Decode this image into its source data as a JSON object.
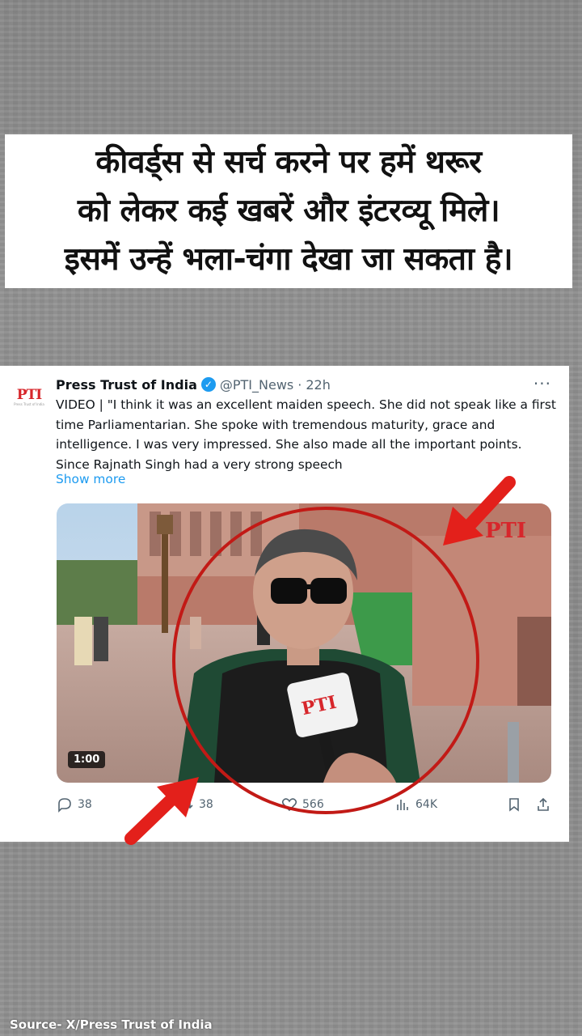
{
  "headline": {
    "lines": [
      "कीवर्ड्स से सर्च करने पर हमें थरूर",
      "को लेकर कई खबरें और इंटरव्यू मिले।",
      "इसमें उन्हें भला-चंगा देखा जा सकता है।"
    ]
  },
  "tweet": {
    "avatar_text": "PTI",
    "avatar_subtext": "Press Trust of India",
    "name": "Press Trust of India",
    "handle": "@PTI_News",
    "separator": "·",
    "time": "22h",
    "more_label": "···",
    "text": "VIDEO | \"I think it was an excellent maiden speech. She did not speak like a first time Parliamentarian. She spoke with tremendous maturity, grace and intelligence. I was very impressed. She also made all the important points. Since Rajnath Singh had a very strong speech",
    "show_more": "Show more",
    "video": {
      "duration": "1:00",
      "watermark": "PTI",
      "mic_label": "PTI"
    },
    "actions": {
      "replies": "38",
      "reposts": "38",
      "likes": "566",
      "views": "64K"
    }
  },
  "source": "Source- X/Press Trust of India",
  "colors": {
    "annotation_red": "#e3201b",
    "link_blue": "#1d9bf0",
    "background_gray": "#8f8f8f"
  }
}
